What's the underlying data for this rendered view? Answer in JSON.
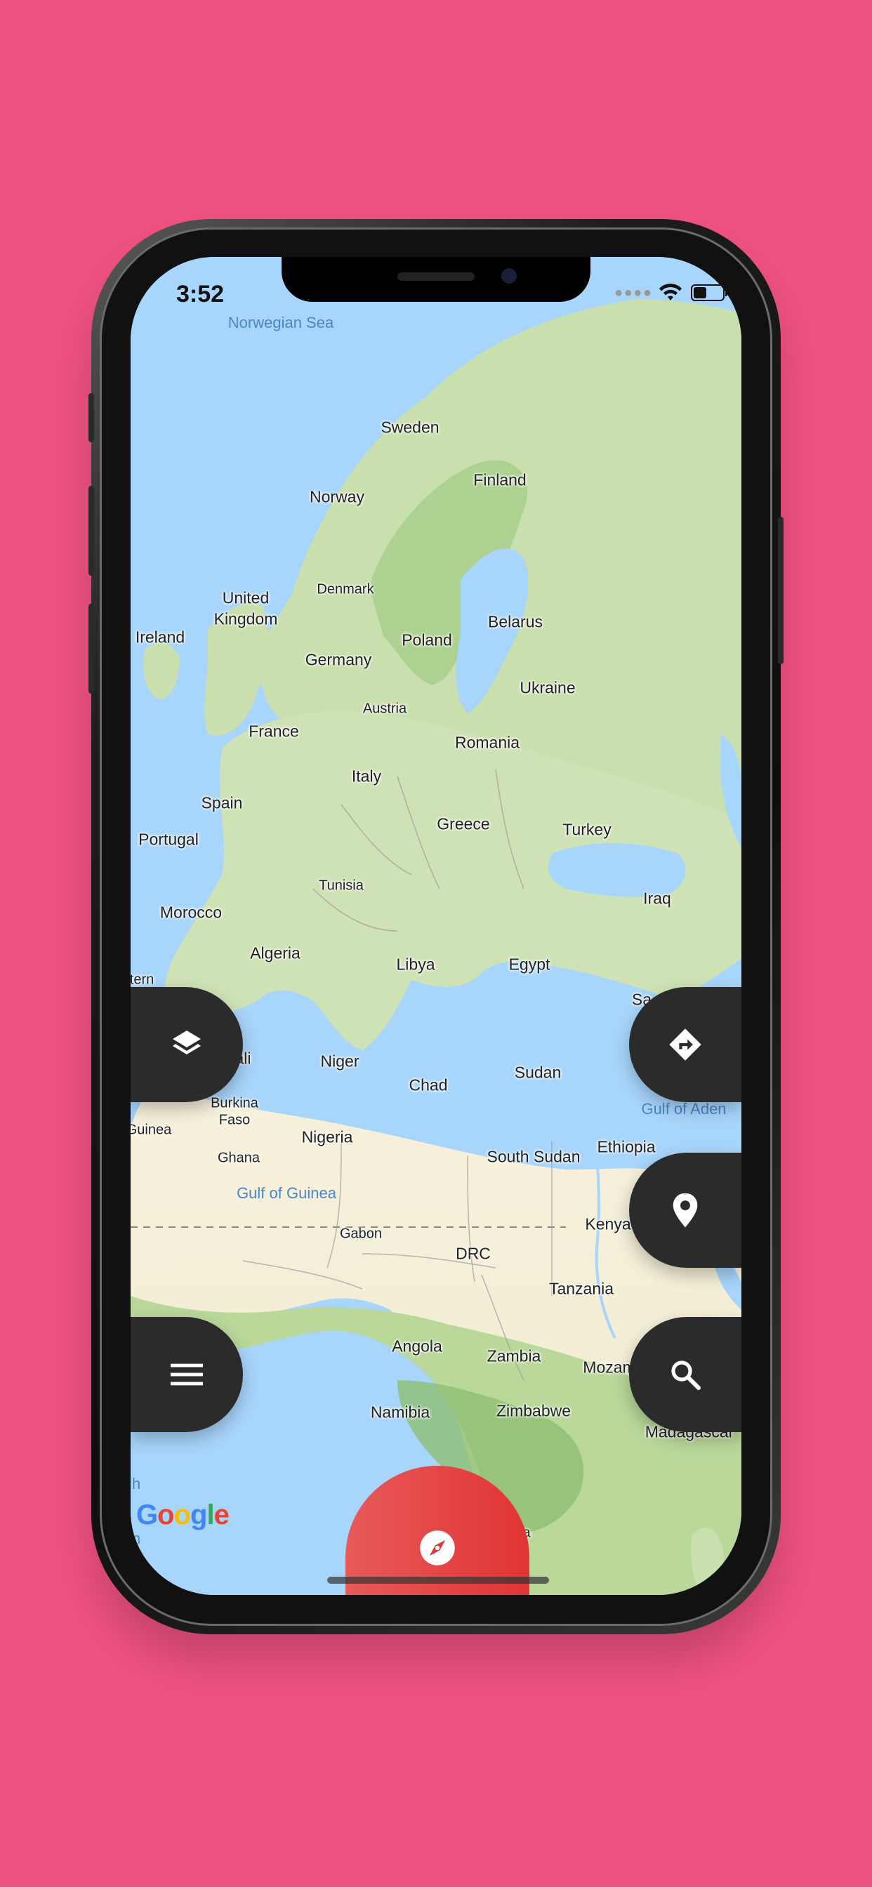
{
  "status_bar": {
    "time": "3:52",
    "battery_percent": 45
  },
  "map": {
    "attribution": "Google",
    "water_labels": {
      "norwegian_sea": "Norwegian Sea",
      "gulf_of_guinea": "Gulf of Guinea",
      "gulf_of_aden": "Gulf of Aden"
    },
    "country_labels": {
      "sweden": "Sweden",
      "finland": "Finland",
      "norway": "Norway",
      "united_kingdom_1": "United",
      "united_kingdom_2": "Kingdom",
      "denmark": "Denmark",
      "ireland": "Ireland",
      "belarus": "Belarus",
      "poland": "Poland",
      "germany": "Germany",
      "ukraine": "Ukraine",
      "austria": "Austria",
      "france": "France",
      "romania": "Romania",
      "italy": "Italy",
      "spain": "Spain",
      "greece": "Greece",
      "portugal": "Portugal",
      "turkey": "Turkey",
      "tunisia": "Tunisia",
      "iraq": "Iraq",
      "morocco": "Morocco",
      "algeria": "Algeria",
      "libya": "Libya",
      "egypt": "Egypt",
      "saudi_partial": "Sa",
      "mali_partial": "ali",
      "niger": "Niger",
      "chad": "Chad",
      "sudan": "Sudan",
      "burkina_faso_1": "Burkina",
      "burkina_faso_2": "Faso",
      "guinea_partial": "Guinea",
      "nigeria": "Nigeria",
      "ethiopia": "Ethiopia",
      "ghana": "Ghana",
      "south_sudan": "South Sudan",
      "gabon": "Gabon",
      "kenya": "Kenya",
      "drc": "DRC",
      "tanzania": "Tanzania",
      "angola": "Angola",
      "zambia": "Zambia",
      "mozambique_partial": "Mozam",
      "namibia": "Namibia",
      "zimbabwe": "Zimbabwe",
      "madagascar_partial": "Madagascar",
      "western_sahara_partial": "tern",
      "south_africa_partial": "a",
      "cut_h": "h",
      "cut_n": "n"
    }
  },
  "controls": {
    "layers": "layers-icon",
    "directions": "directions-icon",
    "location": "location-pin-icon",
    "menu": "menu-icon",
    "search": "search-icon",
    "compass": "compass-icon"
  },
  "colors": {
    "background": "#F05282",
    "fab": "#2B2B2B",
    "compass": "#E13434",
    "water": "#A8D5FB"
  }
}
